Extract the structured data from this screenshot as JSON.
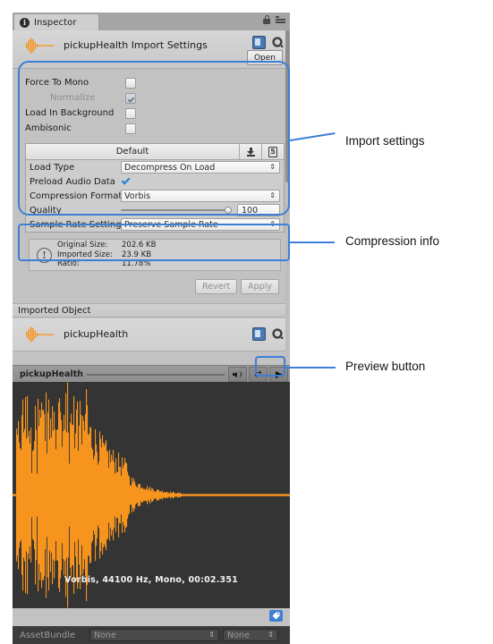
{
  "window": {
    "tab": {
      "label": "Inspector",
      "icon": "info-icon"
    },
    "lock_icon": "lock-icon",
    "menu_icon": "hamburger-menu-icon",
    "asset_title": "pickupHealth Import Settings",
    "open_button": "Open",
    "book_icon": "book-help-icon",
    "gear_icon": "gear-icon"
  },
  "import_settings": {
    "toggles": [
      {
        "label": "Force To Mono",
        "checked": false,
        "dimmed": false
      },
      {
        "label": "Normalize",
        "checked": true,
        "dimmed": true
      },
      {
        "label": "Load In Background",
        "checked": false,
        "dimmed": false
      },
      {
        "label": "Ambisonic",
        "checked": false,
        "dimmed": false
      }
    ],
    "platform_tabs": {
      "default_label": "Default",
      "icons": [
        "standalone-download-icon",
        "html5-platform-icon"
      ]
    },
    "rows": [
      {
        "label": "Load Type",
        "type": "dropdown",
        "value": "Decompress On Load"
      },
      {
        "label": "Preload Audio Data",
        "type": "checkbox",
        "checked": true
      },
      {
        "label": "Compression Format",
        "type": "dropdown",
        "value": "Vorbis"
      },
      {
        "label": "Quality",
        "type": "slider",
        "value": "100",
        "slider_percent": 100
      },
      {
        "label": "Sample Rate Setting",
        "type": "dropdown",
        "value": "Preserve Sample Rate"
      }
    ]
  },
  "compression_info": {
    "warn_icon": "exclamation-icon",
    "lines": [
      {
        "key": "Original Size:",
        "value": "202.6 KB"
      },
      {
        "key": "Imported Size:",
        "value": "23.9 KB"
      },
      {
        "key": "Ratio:",
        "value": "11.78%"
      }
    ]
  },
  "actions": {
    "revert": "Revert",
    "apply": "Apply"
  },
  "imported_object": {
    "header": "Imported Object",
    "name": "pickupHealth",
    "book_icon": "book-help-icon",
    "gear_icon": "gear-icon"
  },
  "preview": {
    "clip_name": "pickupHealth",
    "volume_icon": "speaker-icon",
    "loop_icon": "loop-icon",
    "play_icon": "play-icon",
    "caption": "Vorbis, 44100 Hz, Mono, 00:02.351",
    "tag_icon": "tag-icon",
    "waveform_color": "#F7941E",
    "background_color": "#343434"
  },
  "assetbundle": {
    "label": "AssetBundle",
    "bundle_value": "None",
    "variant_value": "None"
  },
  "annotations": {
    "accent_color": "#3D7FD6",
    "items": [
      {
        "text": "Import settings"
      },
      {
        "text": "Compression info"
      },
      {
        "text": "Preview button"
      }
    ]
  }
}
